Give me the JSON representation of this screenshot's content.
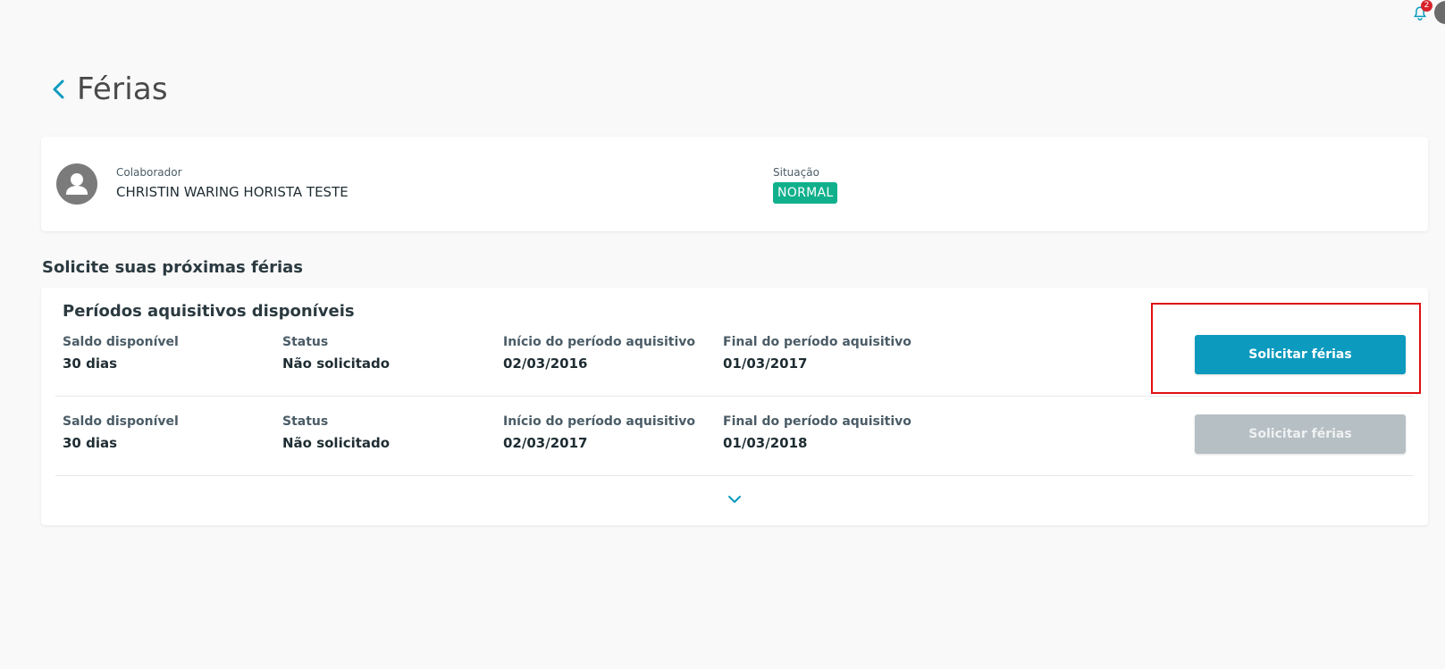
{
  "topbar": {
    "notifications_count": "2"
  },
  "header": {
    "title": "Férias"
  },
  "employee": {
    "collaborator_label": "Colaborador",
    "collaborator_name": "CHRISTIN WARING HORISTA TESTE",
    "situation_label": "Situação",
    "situation_value": "NORMAL",
    "situation_color": "#10b08c"
  },
  "request_section": {
    "title": "Solicite suas próximas férias",
    "card_title": "Períodos aquisitivos disponíveis",
    "columns": {
      "balance": "Saldo disponível",
      "status": "Status",
      "start": "Início do período aquisitivo",
      "end": "Final do período aquisitivo"
    },
    "periods": [
      {
        "balance": "30 dias",
        "status": "Não solicitado",
        "start": "02/03/2016",
        "end": "01/03/2017",
        "button_label": "Solicitar férias",
        "button_enabled": true
      },
      {
        "balance": "30 dias",
        "status": "Não solicitado",
        "start": "02/03/2017",
        "end": "01/03/2018",
        "button_label": "Solicitar férias",
        "button_enabled": false
      }
    ]
  },
  "colors": {
    "accent": "#0c9abe",
    "disabled": "#b6bfc3",
    "highlight": "#e01010"
  },
  "icons": {
    "bell": "bell-icon",
    "back": "chevron-left-icon",
    "avatar": "user-icon",
    "info": "info-icon",
    "expand": "chevron-down-icon"
  }
}
